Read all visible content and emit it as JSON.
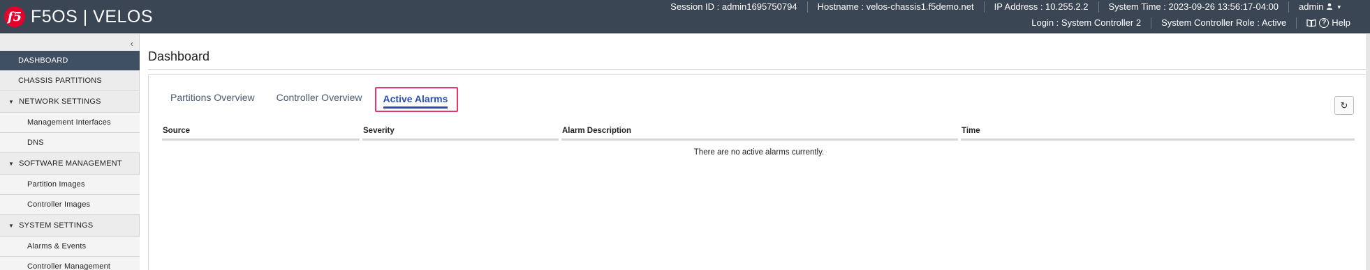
{
  "header": {
    "logo_text": "f5",
    "product": "F5OS | VELOS",
    "session_id": "Session ID : admin1695750794",
    "hostname": "Hostname : velos-chassis1.f5demo.net",
    "ip_address": "IP Address : 10.255.2.2",
    "system_time": "System Time : 2023-09-26 13:56:17-04:00",
    "user": "admin",
    "login": "Login : System Controller 2",
    "role": "System Controller Role : Active",
    "help": "Help"
  },
  "sidebar": {
    "collapse_glyph": "‹",
    "items": [
      {
        "label": "DASHBOARD"
      },
      {
        "label": "CHASSIS PARTITIONS"
      },
      {
        "label": "NETWORK SETTINGS"
      },
      {
        "label": "Management Interfaces"
      },
      {
        "label": "DNS"
      },
      {
        "label": "SOFTWARE MANAGEMENT"
      },
      {
        "label": "Partition Images"
      },
      {
        "label": "Controller Images"
      },
      {
        "label": "SYSTEM SETTINGS"
      },
      {
        "label": "Alarms & Events"
      },
      {
        "label": "Controller Management"
      }
    ]
  },
  "main": {
    "title": "Dashboard",
    "tabs": [
      {
        "label": "Partitions Overview"
      },
      {
        "label": "Controller Overview"
      },
      {
        "label": "Active Alarms"
      }
    ],
    "refresh_glyph": "↻",
    "table": {
      "columns": [
        "Source",
        "Severity",
        "Alarm Description",
        "Time"
      ],
      "empty_message": "There are no active alarms currently."
    }
  },
  "colors": {
    "header_bg": "#3a4654",
    "active_nav_bg": "#3f5062",
    "active_tab": "#2a4eb5",
    "highlight_border": "#e8366a",
    "logo_red": "#e4002b"
  }
}
